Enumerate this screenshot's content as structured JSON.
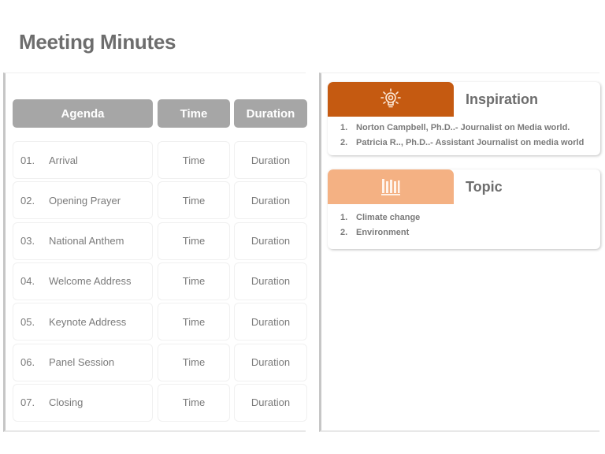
{
  "title": "Meeting Minutes",
  "agenda_table": {
    "headers": {
      "agenda": "Agenda",
      "time": "Time",
      "duration": "Duration"
    },
    "rows": [
      {
        "num": "01.",
        "item": "Arrival",
        "time": "Time",
        "duration": "Duration"
      },
      {
        "num": "02.",
        "item": "Opening Prayer",
        "time": "Time",
        "duration": "Duration"
      },
      {
        "num": "03.",
        "item": "National Anthem",
        "time": "Time",
        "duration": "Duration"
      },
      {
        "num": "04.",
        "item": "Welcome Address",
        "time": "Time",
        "duration": "Duration"
      },
      {
        "num": "05.",
        "item": "Keynote Address",
        "time": "Time",
        "duration": "Duration"
      },
      {
        "num": "06.",
        "item": "Panel Session",
        "time": "Time",
        "duration": "Duration"
      },
      {
        "num": "07.",
        "item": "Closing",
        "time": "Time",
        "duration": "Duration"
      }
    ]
  },
  "inspiration": {
    "heading": "Inspiration",
    "icon": "lightbulb-icon",
    "color": "#c55a11",
    "items": [
      {
        "num": "1.",
        "text": "Norton Campbell, Ph.D..- Journalist on Media world."
      },
      {
        "num": "2.",
        "text": "Patricia R.., Ph.D..- Assistant Journalist on media world"
      }
    ]
  },
  "topic": {
    "heading": "Topic",
    "icon": "books-icon",
    "color": "#f4b183",
    "items": [
      {
        "num": "1.",
        "text": "Climate change"
      },
      {
        "num": "2.",
        "text": "Environment"
      }
    ]
  }
}
